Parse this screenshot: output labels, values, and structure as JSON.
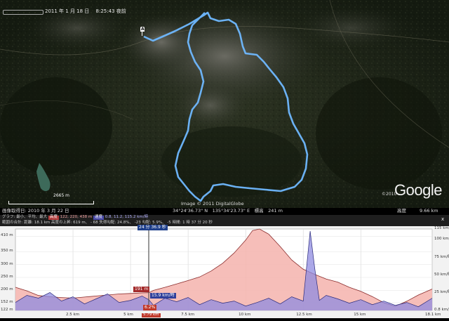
{
  "map": {
    "date_stamp": "2011 年 1 月 18 日 　8:25:43 夜前",
    "waypoint_label": "A",
    "scale_label": "2665 m",
    "copyright": "Image © 2011 DigitalGlobe",
    "year_mark": "©2010",
    "logo_text": "Google"
  },
  "status": {
    "capture_date": "画像取得日: 2010 年 3 月 22 日",
    "coordinates": "34°24'36.73\" N　135°34'23.73\" E　標高　241 m",
    "altitude_label": "高度",
    "altitude_value": "9.66 km"
  },
  "profile_header": {
    "line1_prefix": "グラフ: 最小、平均、最大",
    "elev_label": "高度",
    "elev_values": "122, 220, 438 m",
    "speed_label": "速度",
    "speed_values": "0.8, 11.2, 115.2 km/時",
    "line2": "範囲の合計: 距離: 18.1 km 高度の上昇: 619 m、 - 68 失得勾配: 24.8%、 -23 勾配: 5.9%、 -5 時間: 1 時 37 分 20 秒",
    "close_label": "x"
  },
  "chart_data": {
    "type": "area",
    "x_ticks": [
      "2.5 km",
      "5 km",
      "5.79 km",
      "7.5 km",
      "10 km",
      "12.5 km",
      "15 km",
      "18.1 km"
    ],
    "x_tick_values": [
      2.5,
      5,
      5.79,
      7.5,
      10,
      12.5,
      15,
      18.1
    ],
    "xlim": [
      0,
      18.1
    ],
    "left_ticks": [
      "410 m",
      "350 m",
      "300 m",
      "250 m",
      "200 m",
      "152 m",
      "122 m"
    ],
    "left_tick_values": [
      410,
      350,
      300,
      250,
      200,
      152,
      122
    ],
    "ylim_left": [
      122,
      438
    ],
    "right_ticks": [
      "115 km/時",
      "100 km/時",
      "75 km/時",
      "50 km/時",
      "25 km/時",
      "0.8 km/時"
    ],
    "right_tick_values": [
      115,
      100,
      75,
      50,
      25,
      0.8
    ],
    "ylim_right": [
      0.8,
      115
    ],
    "cursor_x": 5.79,
    "cursor_label": "24 分 36.9 秒",
    "cursor_elev_label": "191 m",
    "cursor_speed_label": "15.9 km/時",
    "cursor_grade_label": "6.2%",
    "series": [
      {
        "name": "高度",
        "x": [
          0,
          0.5,
          1,
          1.5,
          2,
          2.5,
          3,
          3.5,
          4,
          4.5,
          5,
          5.5,
          5.79,
          6,
          6.5,
          7,
          7.5,
          8,
          8.5,
          9,
          9.5,
          10,
          10.3,
          10.6,
          11,
          11.5,
          12,
          12.5,
          13,
          13.5,
          14,
          14.5,
          15,
          15.5,
          16,
          16.5,
          17,
          17.5,
          18.1
        ],
        "values": [
          212,
          198,
          180,
          175,
          172,
          170,
          174,
          178,
          182,
          186,
          188,
          190,
          191,
          200,
          212,
          225,
          238,
          252,
          275,
          305,
          345,
          395,
          432,
          438,
          418,
          370,
          318,
          282,
          262,
          244,
          232,
          212,
          196,
          176,
          152,
          138,
          158,
          182,
          205
        ]
      },
      {
        "name": "速度",
        "x": [
          0,
          0.5,
          1,
          1.5,
          2,
          2.5,
          3,
          3.5,
          4,
          4.5,
          5,
          5.5,
          5.79,
          6,
          6.5,
          7,
          7.5,
          8,
          8.5,
          9,
          9.5,
          10,
          10.5,
          11,
          11.5,
          12,
          12.5,
          12.8,
          13,
          13.2,
          13.5,
          14,
          14.5,
          15,
          15.5,
          16,
          16.5,
          17,
          17.5,
          18.1
        ],
        "values": [
          12,
          22,
          18,
          26,
          14,
          20,
          10,
          17,
          24,
          12,
          15,
          21,
          15.9,
          8,
          18,
          13,
          19,
          9,
          16,
          11,
          14,
          7,
          12,
          18,
          10,
          20,
          14,
          112,
          60,
          15,
          22,
          17,
          11,
          16,
          9,
          14,
          8,
          12,
          6,
          18
        ]
      }
    ]
  },
  "colors": {
    "track": "#6fb8ff",
    "elev_fill": "#f5b3ad",
    "speed_fill": "#8f8be0",
    "cursor": "#555555"
  }
}
